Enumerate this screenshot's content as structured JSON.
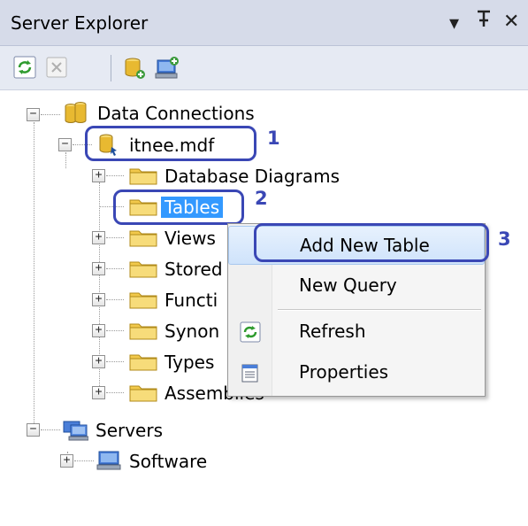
{
  "panel": {
    "title": "Server Explorer",
    "dropdown_glyph": "▾",
    "pin_glyph": "ꟷ",
    "close_glyph": "✕"
  },
  "toolbar": {
    "icons": [
      "refresh-icon",
      "stop-refresh-icon",
      "connect-to-database-icon",
      "connect-to-server-icon"
    ]
  },
  "tree": {
    "expand_glyph": "+",
    "collapse_glyph": "−",
    "data_connections": "Data Connections",
    "database": "itnee.mdf",
    "children": [
      "Database Diagrams",
      "Tables",
      "Views",
      "Stored",
      "Functi",
      "Synon",
      "Types",
      "Assemblies"
    ],
    "servers": "Servers",
    "software": "Software"
  },
  "context_menu": {
    "items": [
      "Add New Table",
      "New Query",
      "Refresh",
      "Properties"
    ]
  },
  "annotations": {
    "labels": [
      "1",
      "2",
      "3"
    ],
    "color": "#3a47b5"
  },
  "colors": {
    "selection": "#3399ff",
    "folder": "#f2c94c"
  }
}
